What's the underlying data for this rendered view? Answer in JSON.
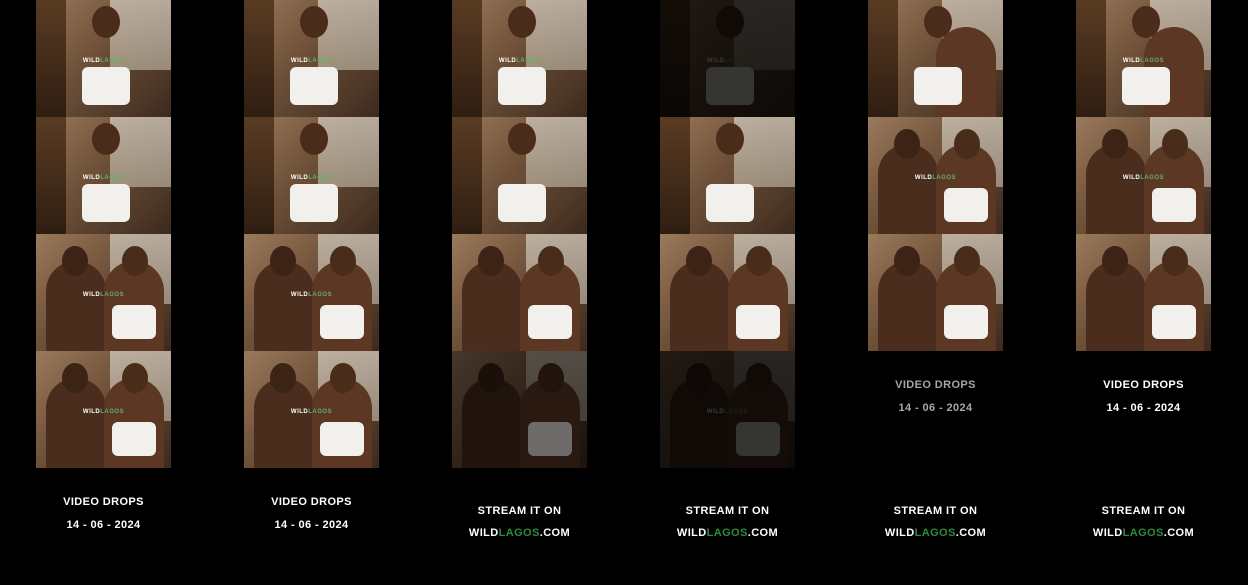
{
  "columns": [
    {
      "frames": 4,
      "caption_line1": "VIDEO DROPS",
      "caption_line2": "14 - 06 - 2024"
    },
    {
      "frames": 4,
      "caption_line1": "VIDEO DROPS",
      "caption_line2": "14 - 06 - 2024"
    },
    {
      "frames": 4,
      "caption_line1": "STREAM IT ON",
      "link_prefix": "WILD",
      "link_accent": "LAGOS",
      "link_suffix": ".COM"
    },
    {
      "frames": 4,
      "caption_line1": "STREAM IT ON",
      "link_prefix": "WILD",
      "link_accent": "LAGOS",
      "link_suffix": ".COM"
    },
    {
      "frames": 3,
      "date_line1": "VIDEO DROPS",
      "date_line2": "14 - 06 - 2024",
      "caption_line1": "STREAM IT ON",
      "link_prefix": "WILD",
      "link_accent": "LAGOS",
      "link_suffix": ".COM"
    },
    {
      "frames": 3,
      "date_line1": "VIDEO DROPS",
      "date_line2": "14 - 06 - 2024",
      "caption_line1": "STREAM IT ON",
      "link_prefix": "WILD",
      "link_accent": "LAGOS",
      "link_suffix": ".COM"
    }
  ],
  "watermark": {
    "part_a": "WILD",
    "part_b": "LAGOS"
  },
  "colors": {
    "background": "#000000",
    "caption": "#ffffff",
    "caption_muted": "#a6a6a6",
    "brand_accent": "#2e8b3a"
  }
}
